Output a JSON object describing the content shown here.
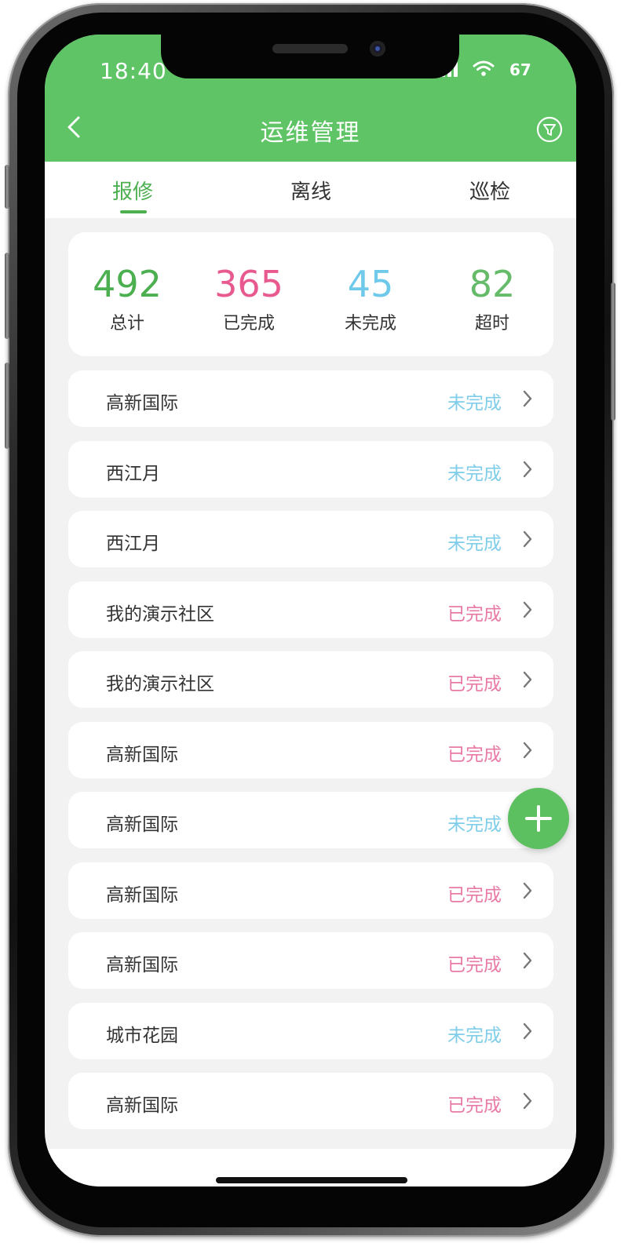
{
  "status_bar": {
    "time": "18:40",
    "battery": "67"
  },
  "header": {
    "title": "运维管理"
  },
  "tabs": [
    {
      "label": "报修",
      "active": true
    },
    {
      "label": "离线",
      "active": false
    },
    {
      "label": "巡检",
      "active": false
    }
  ],
  "stats": [
    {
      "value": "492",
      "label": "总计",
      "color": "#4caf50"
    },
    {
      "value": "365",
      "label": "已完成",
      "color": "#e85a8f"
    },
    {
      "value": "45",
      "label": "未完成",
      "color": "#6fc9ea"
    },
    {
      "value": "82",
      "label": "超时",
      "color": "#66bb6a"
    }
  ],
  "status_colors": {
    "未完成": "#7fcde8",
    "已完成": "#e87aa6"
  },
  "items": [
    {
      "name": "高新国际",
      "status": "未完成"
    },
    {
      "name": "西江月",
      "status": "未完成"
    },
    {
      "name": "西江月",
      "status": "未完成"
    },
    {
      "name": "我的演示社区",
      "status": "已完成"
    },
    {
      "name": "我的演示社区",
      "status": "已完成"
    },
    {
      "name": "高新国际",
      "status": "已完成"
    },
    {
      "name": "高新国际",
      "status": "未完成"
    },
    {
      "name": "高新国际",
      "status": "已完成"
    },
    {
      "name": "高新国际",
      "status": "已完成"
    },
    {
      "name": "城市花园",
      "status": "未完成"
    },
    {
      "name": "高新国际",
      "status": "已完成"
    }
  ],
  "icons": {
    "back": "chevron-left-icon",
    "filter": "filter-icon",
    "row": "chevron-right-icon",
    "fab": "plus-icon"
  }
}
